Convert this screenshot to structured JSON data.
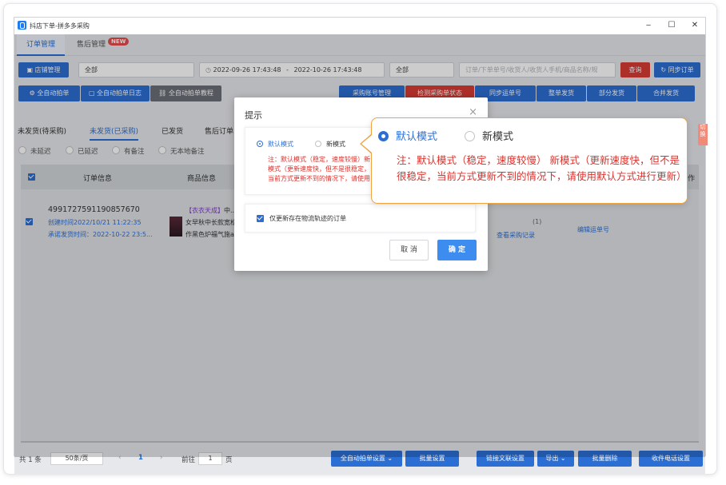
{
  "window": {
    "title": "抖店下单-拼多多采购",
    "min": "‒",
    "max": "☐",
    "close": "✕"
  },
  "top_tabs": [
    {
      "label": "订单管理"
    },
    {
      "label": "售后管理"
    }
  ],
  "new_badge": "NEW",
  "filters": {
    "shop_button": "店铺管理",
    "shop_value": "全部",
    "date_start": "2022-09-26 17:43:48",
    "date_sep": "-",
    "date_end": "2022-10-26 17:43:48",
    "status_value": "全部",
    "search_placeholder": "订单/下单单号/收货人/收货人手机/商品名称/规",
    "query_button": "查询",
    "sync_button": "同步订单"
  },
  "action_buttons": {
    "auto_buy": "全自动拍单",
    "auto_buy_log": "全自动拍单日志",
    "auto_buy_tutorial": "全自动拍单教程",
    "purchase_account": "采购账号管理",
    "detect_status": "检测采购单状态",
    "sync_tracking": "同步运单号",
    "whole_ship": "整单发货",
    "partial_ship": "部分发货",
    "merge_ship": "合并发货"
  },
  "order_tabs": [
    "未发货(待采购)",
    "未发货(已采购)",
    "已发货",
    "售后订单"
  ],
  "radio_filters": [
    "未延迟",
    "已延迟",
    "有备注",
    "无本地备注"
  ],
  "table": {
    "headers": {
      "order_info": "订单信息",
      "product_info": "商品信息",
      "last": "作"
    },
    "row": {
      "order_id": "4991727591190857670",
      "created": "创建时间2022/10/21 11:22:35",
      "latest_ship": "承诺发货时间：2022-10-22 23:5...",
      "shop_tag": "【衣衣天成】",
      "shop_tag_rest": "中...",
      "product_line1": "女早秋中长款宽松...",
      "product_line2": "作黑色炉福气施a...",
      "count_label": "(1)",
      "view_purchase": "查看采购记录",
      "edit_tracking": "编辑运单号"
    }
  },
  "footer": {
    "total": "共 1 条",
    "page_size": "50条/页",
    "prev": "‹",
    "page": "1",
    "next": "›",
    "goto_label": "前往",
    "goto_value": "1",
    "page_unit": "页",
    "btn_auto_settings": "全自动拍单设置",
    "btn_batch_settings": "批量设置",
    "btn_link_settings": "链接文联设置",
    "btn_export": "导出",
    "btn_batch_delete": "批量删除",
    "btn_receiver_settings": "收件电话设置"
  },
  "dialog": {
    "title": "提示",
    "close": "×",
    "mode_default": "默认模式",
    "mode_new": "新模式",
    "note_small": "注：默认模式（稳定，速度较慢）新模式（更新速度快，但不是很稳定，当前方式更新不到的情况下，请使用默认方式进行更新）",
    "only_update_label": "仅更新存在物流轨迹的订单",
    "cancel": "取 消",
    "ok": "确 定"
  },
  "zoom": {
    "mode_default": "默认模式",
    "mode_new": "新模式",
    "note": "注：默认模式（稳定，速度较慢） 新模式（更新速度快，但不是很稳定，当前方式更新不到的情况下，请使用默认方式进行更新）"
  },
  "side_tag": "切换",
  "colors": {
    "primary": "#2c6fd4",
    "danger": "#d93b35",
    "note_red": "#d9322c",
    "callout_border": "#f0a340"
  }
}
